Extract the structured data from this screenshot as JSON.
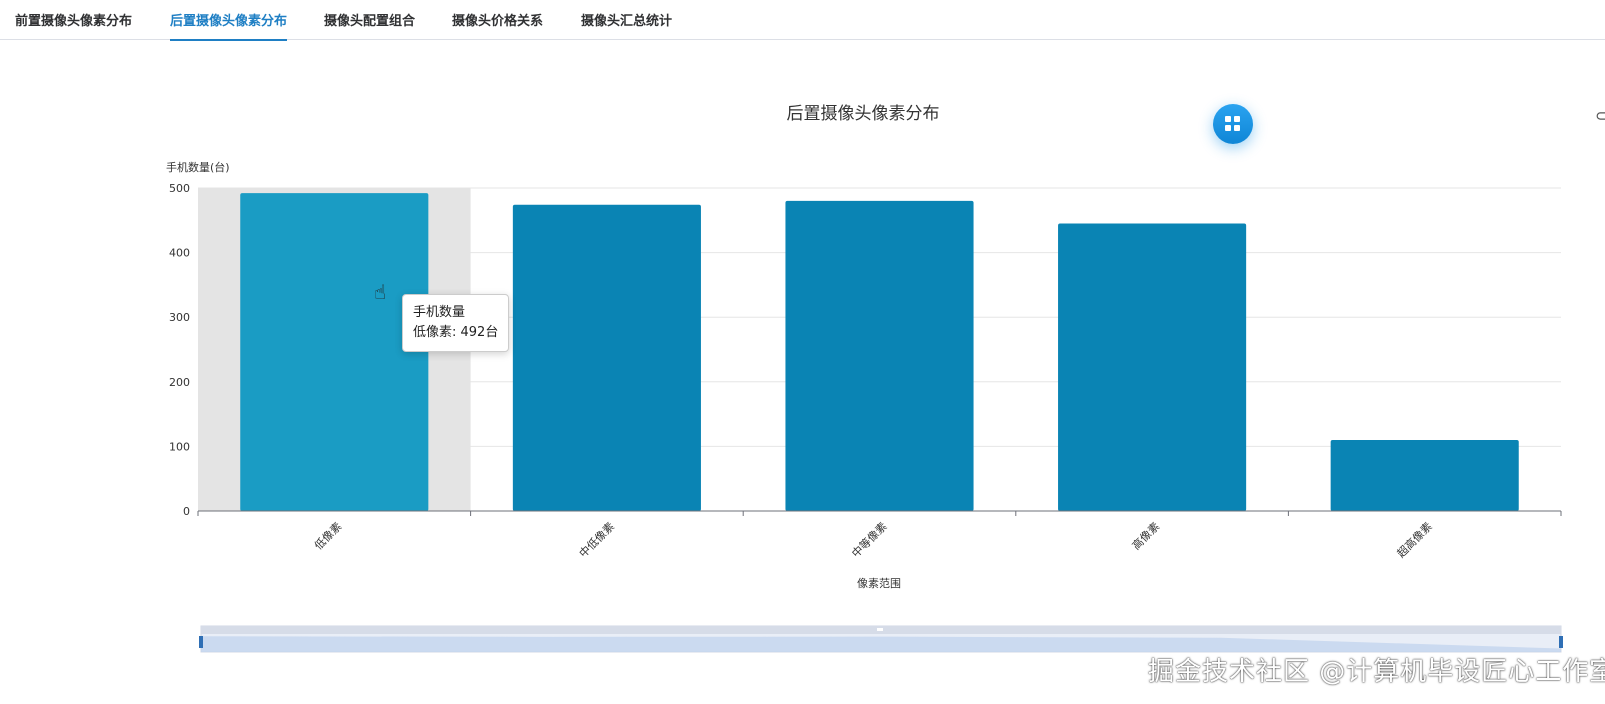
{
  "tabs": [
    {
      "label": "前置摄像头像素分布",
      "active": false
    },
    {
      "label": "后置摄像头像素分布",
      "active": true
    },
    {
      "label": "摄像头配置组合",
      "active": false
    },
    {
      "label": "摄像头价格关系",
      "active": false
    },
    {
      "label": "摄像头汇总统计",
      "active": false
    }
  ],
  "toolbox": {
    "icon": "grid-icon"
  },
  "colors": {
    "accent": "#1f7fc4",
    "bar": "#0a84b4",
    "bar_highlight": "#1a9cc4",
    "hover_band": "#e4e4e4"
  },
  "tooltip": {
    "series": "手机数量",
    "line": "低像素: 492台"
  },
  "watermark": "掘金技术社区 @计算机毕设匠心工作室",
  "chart_data": {
    "type": "bar",
    "title": "后置摄像头像素分布",
    "ylabel": "手机数量(台)",
    "xlabel": "像素范围",
    "categories": [
      "低像素",
      "中低像素",
      "中等像素",
      "高像素",
      "超高像素"
    ],
    "series": [
      {
        "name": "手机数量",
        "values": [
          492,
          474,
          480,
          445,
          110
        ]
      }
    ],
    "ylim": [
      0,
      500
    ],
    "yticks": [
      0,
      100,
      200,
      300,
      400,
      500
    ],
    "grid": true,
    "highlighted_category": "低像素"
  }
}
